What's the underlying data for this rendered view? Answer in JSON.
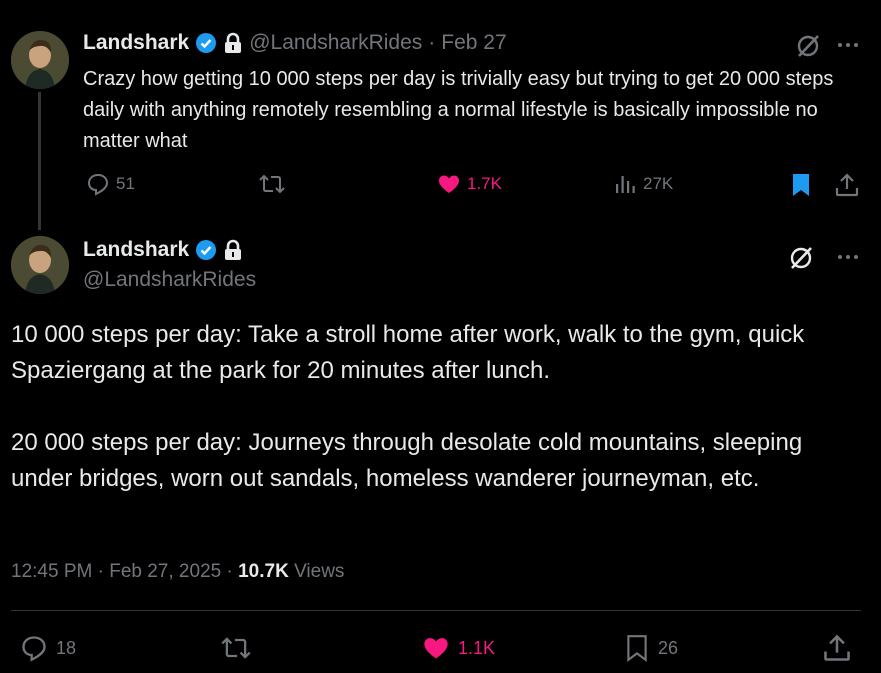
{
  "tweet1": {
    "author_name": "Landshark",
    "handle": "@LandsharkRides",
    "date": "Feb 27",
    "text": "Crazy how getting 10 000 steps per day is trivially easy but trying to get 20 000 steps daily with anything remotely resembling a normal lifestyle is basically impossible no matter what",
    "replies": "51",
    "likes": "1.7K",
    "views": "27K"
  },
  "tweet2": {
    "author_name": "Landshark",
    "handle": "@LandsharkRides",
    "text_para1": "10 000 steps per day: Take a stroll home after work, walk to the gym, quick Spaziergang at the park for 20 minutes after lunch.",
    "text_para2": "20 000 steps per day: Journeys through desolate cold mountains, sleeping under bridges, worn out sandals, homeless wanderer journeyman, etc.",
    "time": "12:45 PM",
    "date": "Feb 27, 2025",
    "views_count": "10.7K",
    "views_label": "Views",
    "replies": "18",
    "likes": "1.1K",
    "bookmarks": "26"
  },
  "colors": {
    "accent": "#1d9bf0",
    "like": "#f91880",
    "muted": "#71767b",
    "text": "#e7e9ea"
  },
  "icons": [
    "verified-badge-icon",
    "lock-icon",
    "grok-icon",
    "more-icon",
    "reply-icon",
    "retweet-icon",
    "heart-icon",
    "views-icon",
    "bookmark-icon",
    "share-icon"
  ]
}
